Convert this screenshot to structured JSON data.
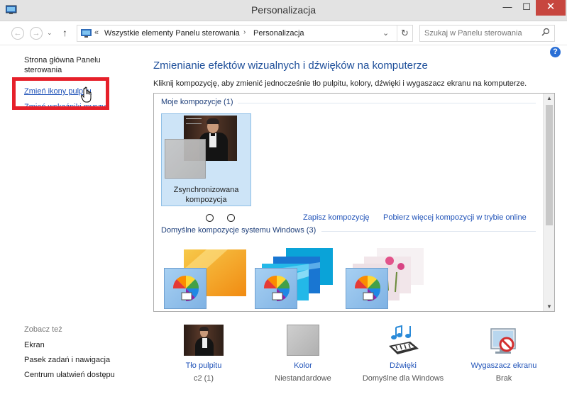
{
  "window": {
    "title": "Personalizacja",
    "minimize": "—",
    "maximize": "☐",
    "close": "✕"
  },
  "nav": {
    "back": "←",
    "forward": "→",
    "recent": "⌄",
    "up": "↑"
  },
  "address": {
    "chevrons": "«",
    "crumb1": "Wszystkie elementy Panelu sterowania",
    "separator": "›",
    "crumb2": "Personalizacja",
    "dropdown": "⌄",
    "refresh": "↻"
  },
  "search": {
    "placeholder": "Szukaj w Panelu sterowania",
    "icon": "search-icon"
  },
  "sidebar": {
    "home": "Strona główna Panelu sterowania",
    "link1": "Zmień ikony pulpitu",
    "link2": "Zmień wskaźniki myszy",
    "see_also": "Zobacz też",
    "see_links": [
      "Ekran",
      "Pasek zadań i nawigacja",
      "Centrum ułatwień dostępu"
    ]
  },
  "main": {
    "heading": "Zmienianie efektów wizualnych i dźwięków na komputerze",
    "description": "Kliknij kompozycję, aby zmienić jednocześnie tło pulpitu, kolory, dźwięki i wygaszacz ekranu na komputerze.",
    "help": "?",
    "my_themes_header": "Moje kompozycje (1)",
    "selected_theme_label": "Zsynchronizowana kompozycja",
    "save_theme": "Zapisz kompozycję",
    "get_more": "Pobierz więcej kompozycji w trybie online",
    "default_themes_header": "Domyślne kompozycje systemu Windows (3)"
  },
  "bottom": {
    "items": [
      {
        "label": "Tło pulpitu",
        "value": "c2 (1)"
      },
      {
        "label": "Kolor",
        "value": "Niestandardowe"
      },
      {
        "label": "Dźwięki",
        "value": "Domyślne dla Windows"
      },
      {
        "label": "Wygaszacz ekranu",
        "value": "Brak"
      }
    ]
  },
  "colors": {
    "accent": "#1f52b8",
    "heading": "#1e4f9a",
    "highlight": "#e6202a",
    "close_button": "#c7463f",
    "selection": "#cde4f7"
  }
}
